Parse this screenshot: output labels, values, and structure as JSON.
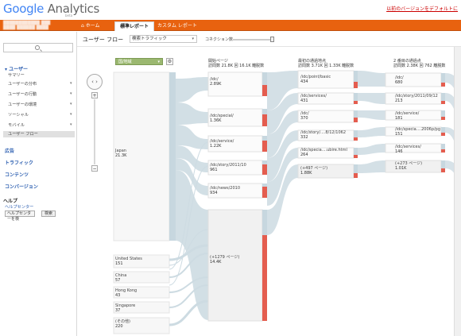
{
  "header": {
    "logo_google": "Google",
    "logo_analytics": "Analytics",
    "logo_beta": "beta",
    "top_link": "以前のバージョンをデフォルトに",
    "account_line1": "████████████ ███",
    "account_line2": "████ ██████ ████"
  },
  "nav": {
    "tabs": [
      {
        "label": "ホーム"
      },
      {
        "label": "標準レポート"
      },
      {
        "label": "カスタム レポート"
      }
    ]
  },
  "sidebar": {
    "search_icon": "search-icon",
    "sections": {
      "users": "ユーザー",
      "summary": "サマリー",
      "distribution": "ユーザーの分布",
      "behavior": "ユーザーの行動",
      "environment": "ユーザーの環境",
      "social": "ソーシャル",
      "mobile": "モバイル",
      "flow": "ユーザー フロー",
      "ads": "広告",
      "traffic": "トラフィック",
      "content": "コンテンツ",
      "conversion": "コンバージョン",
      "help": "ヘルプ",
      "help_center": "ヘルプセンター",
      "help_input": "ヘルプセンターを検",
      "help_button": "検索"
    }
  },
  "toolbar": {
    "title": "ユーザー フロー",
    "segment_select": "検索トラフィック",
    "connection_label": "コネクション数",
    "connection_value": 1.0
  },
  "flow": {
    "dimension_select": "国/地域",
    "columns": [
      {
        "title": "開始ページ",
        "sub": "訪問数 21.8K 回 16.1K 離脱数"
      },
      {
        "title": "最初の通過地点",
        "sub": "訪問数 3.71K 回 1.33K 離脱数"
      },
      {
        "title": "2 番目の通過点",
        "sub": "訪問数 2.38K 回 762 離脱数"
      }
    ],
    "countries": [
      {
        "name": "Japan",
        "value": "21.3K"
      },
      {
        "name": "United States",
        "value": "151"
      },
      {
        "name": "China",
        "value": "57"
      },
      {
        "name": "Hong Kong",
        "value": "43"
      },
      {
        "name": "Singapore",
        "value": "37"
      },
      {
        "name": "(その他)",
        "value": "220"
      }
    ],
    "col1": [
      {
        "page": "/idc/",
        "value": "2.89K"
      },
      {
        "page": "/idc/special/",
        "value": "1.36K"
      },
      {
        "page": "/idc/service/",
        "value": "1.22K"
      },
      {
        "page": "/idc/story/2011/10",
        "value": "961"
      },
      {
        "page": "/idc/news/2010",
        "value": "934"
      },
      {
        "page": "(+1279 ページ)",
        "value": "14.4K"
      }
    ],
    "col2": [
      {
        "page": "/idc/point/basic",
        "value": "434"
      },
      {
        "page": "/idc/services/",
        "value": "431"
      },
      {
        "page": "/idc/",
        "value": "370"
      },
      {
        "page": "/idc/story/....8/12/1062",
        "value": "332"
      },
      {
        "page": "/idc/specia....ubire.html",
        "value": "264"
      },
      {
        "page": "(+497 ページ)",
        "value": "1.88K"
      }
    ],
    "col3": [
      {
        "page": "/idc/",
        "value": "680"
      },
      {
        "page": "/idc/story/2011/09/12",
        "value": "213"
      },
      {
        "page": "/idc/service/",
        "value": "181"
      },
      {
        "page": "/idc/specia....2006p/pg",
        "value": "151"
      },
      {
        "page": "/idc/services/",
        "value": "146"
      },
      {
        "page": "(+273 ページ)",
        "value": "1.01K"
      }
    ]
  }
}
